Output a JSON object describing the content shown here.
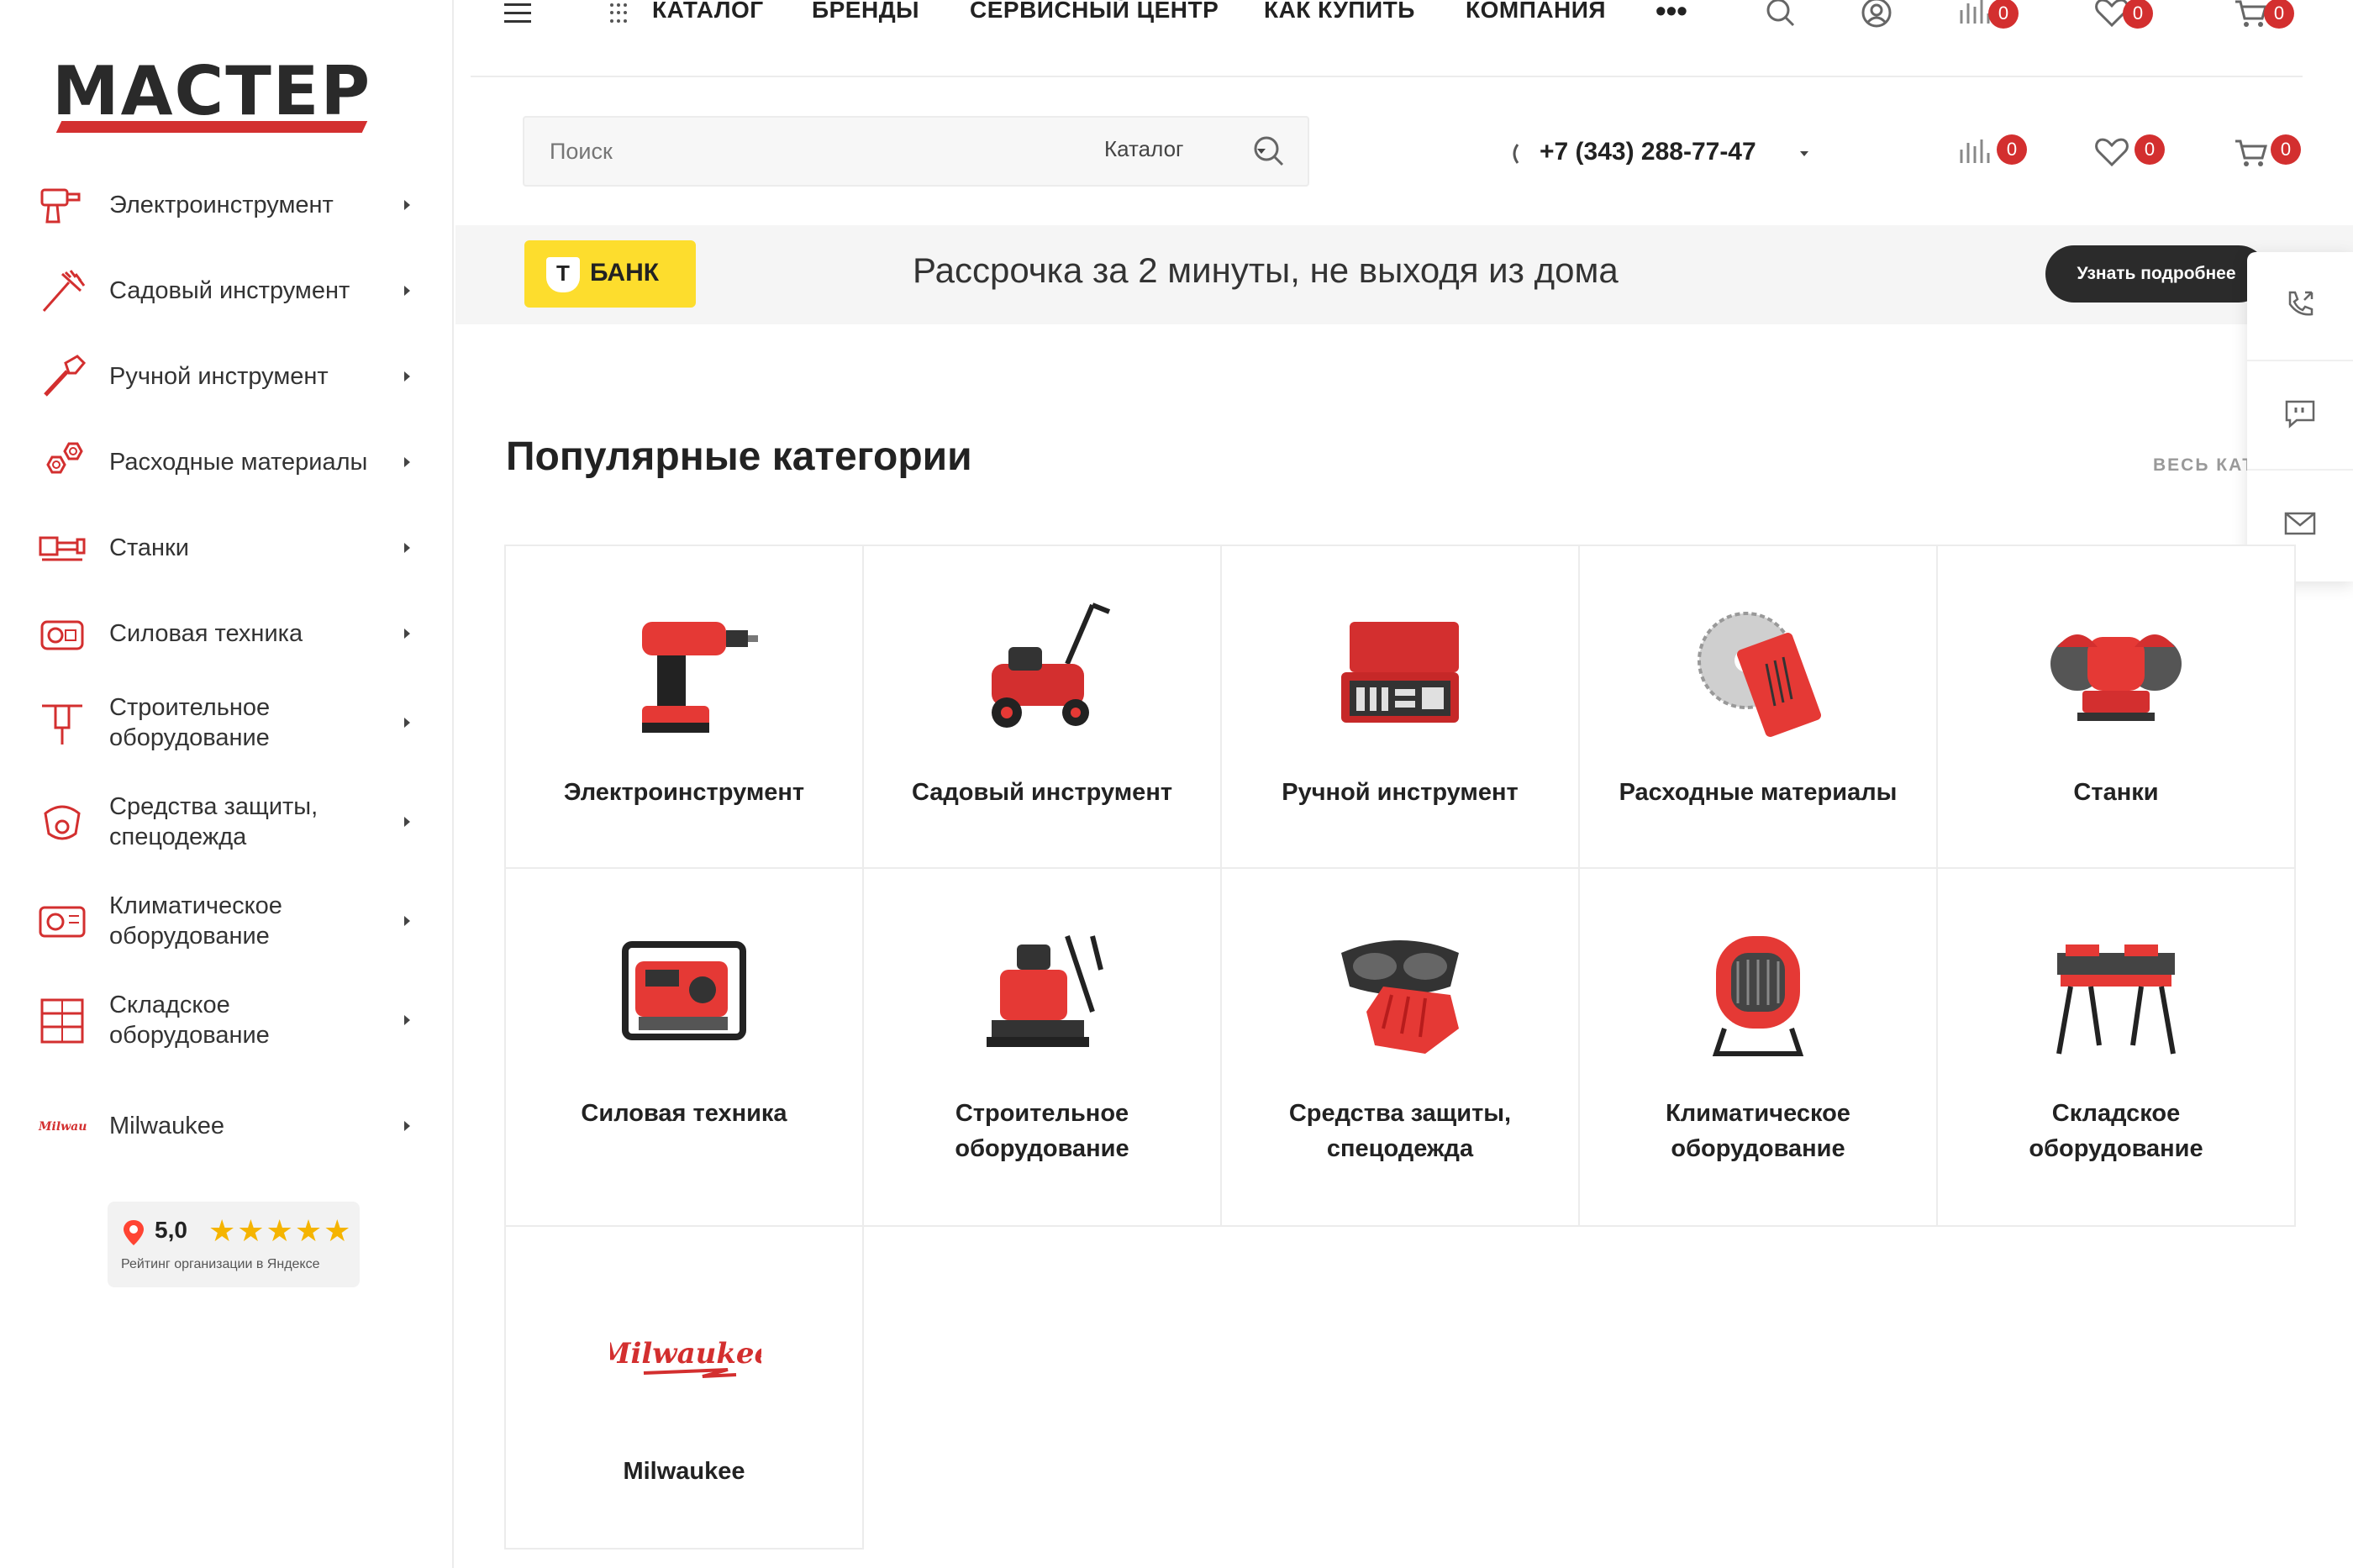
{
  "logo": {
    "text": "МАСТЕР"
  },
  "sidebar": {
    "items": [
      {
        "label": "Электроинструмент",
        "icon": "drill-icon"
      },
      {
        "label": "Садовый инструмент",
        "icon": "rake-icon"
      },
      {
        "label": "Ручной инструмент",
        "icon": "wrench-icon"
      },
      {
        "label": "Расходные материалы",
        "icon": "nuts-icon"
      },
      {
        "label": "Станки",
        "icon": "lathe-icon"
      },
      {
        "label": "Силовая техника",
        "icon": "generator-icon"
      },
      {
        "label": "Строительное оборудование",
        "icon": "jackhammer-icon"
      },
      {
        "label": "Средства защиты, спецодежда",
        "icon": "respirator-icon"
      },
      {
        "label": "Климатическое оборудование",
        "icon": "heater-icon"
      },
      {
        "label": "Складское оборудование",
        "icon": "shelving-icon"
      },
      {
        "label": "Milwaukee",
        "icon": "milwaukee-logo-icon"
      }
    ]
  },
  "rating": {
    "score": "5,0",
    "stars": "★★★★★",
    "caption": "Рейтинг организации в Яндексе"
  },
  "nav": {
    "links": [
      "КАТАЛОГ",
      "БРЕНДЫ",
      "СЕРВИСНЫЙ ЦЕНТР",
      "КАК КУПИТЬ",
      "КОМПАНИЯ"
    ],
    "more": "•••",
    "compare_count": "0",
    "favorites_count": "0",
    "cart_count": "0"
  },
  "header": {
    "search_placeholder": "Поиск",
    "search_scope": "Каталог",
    "phone": "+7 (343) 288-77-47",
    "compare_count": "0",
    "favorites_count": "0",
    "cart_count": "0"
  },
  "banner": {
    "brand": "БАНК",
    "brand_mark": "Т",
    "text": "Рассрочка за 2 минуты, не выходя из дома",
    "button": "Узнать подробнее"
  },
  "section": {
    "title": "Популярные категории",
    "all_link": "ВЕСЬ КАТ"
  },
  "categories": [
    {
      "label": "Электроинструмент"
    },
    {
      "label": "Садовый инструмент"
    },
    {
      "label": "Ручной инструмент"
    },
    {
      "label": "Расходные материалы"
    },
    {
      "label": "Станки"
    },
    {
      "label_1": "Силовая техника"
    },
    {
      "label_1": "Строительное",
      "label_2": "оборудование"
    },
    {
      "label_1": "Средства защиты,",
      "label_2": "спецодежда"
    },
    {
      "label_1": "Климатическое",
      "label_2": "оборудование"
    },
    {
      "label_1": "Складское",
      "label_2": "оборудование"
    },
    {
      "label": "Milwaukee",
      "logo": "Milwaukee"
    }
  ],
  "colors": {
    "accent": "#d32f2f",
    "yellow": "#fddd2d",
    "dark": "#2b2b2b"
  }
}
